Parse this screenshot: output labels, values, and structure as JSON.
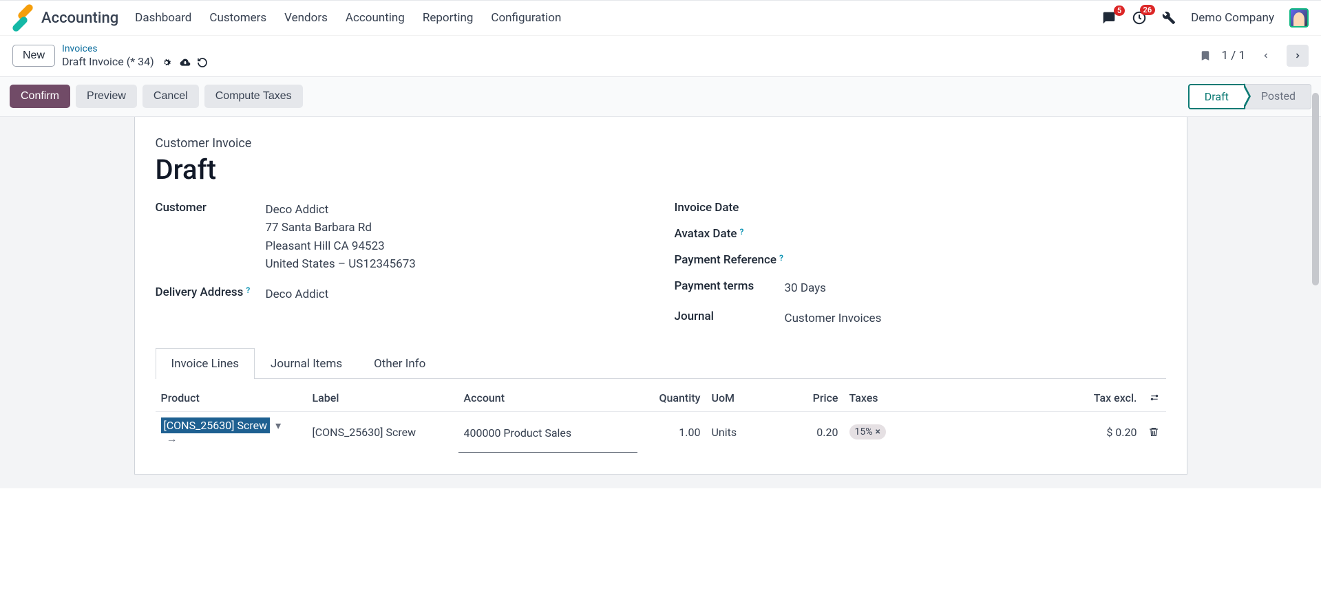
{
  "app": {
    "name": "Accounting"
  },
  "menu": [
    "Dashboard",
    "Customers",
    "Vendors",
    "Accounting",
    "Reporting",
    "Configuration"
  ],
  "topright": {
    "messages_badge": "5",
    "activities_badge": "26",
    "company": "Demo Company"
  },
  "control": {
    "new_label": "New",
    "breadcrumb_parent": "Invoices",
    "breadcrumb_current": "Draft Invoice (* 34)",
    "pager": "1 / 1"
  },
  "actions": {
    "confirm": "Confirm",
    "preview": "Preview",
    "cancel": "Cancel",
    "compute": "Compute Taxes",
    "state_draft": "Draft",
    "state_posted": "Posted"
  },
  "form": {
    "kind": "Customer Invoice",
    "title": "Draft",
    "labels": {
      "customer": "Customer",
      "delivery": "Delivery Address",
      "invoice_date": "Invoice Date",
      "avatax_date": "Avatax Date",
      "payment_ref": "Payment Reference",
      "payment_terms": "Payment terms",
      "journal": "Journal"
    },
    "customer_name": "Deco Addict",
    "customer_addr1": "77 Santa Barbara Rd",
    "customer_addr2": "Pleasant Hill CA 94523",
    "customer_addr3": "United States – US12345673",
    "delivery": "Deco Addict",
    "payment_terms": "30 Days",
    "journal": "Customer Invoices"
  },
  "tabs": [
    "Invoice Lines",
    "Journal Items",
    "Other Info"
  ],
  "table": {
    "headers": {
      "product": "Product",
      "label": "Label",
      "account": "Account",
      "quantity": "Quantity",
      "uom": "UoM",
      "price": "Price",
      "taxes": "Taxes",
      "tax_excl": "Tax excl."
    },
    "row": {
      "product": "[CONS_25630] Screw",
      "label": "[CONS_25630] Screw",
      "account": "400000 Product Sales",
      "quantity": "1.00",
      "uom": "Units",
      "price": "0.20",
      "tax": "15%",
      "tax_excl": "$ 0.20"
    }
  }
}
